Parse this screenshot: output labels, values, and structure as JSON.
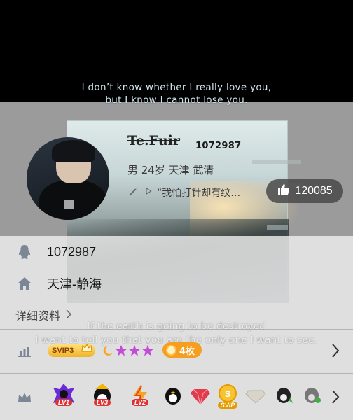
{
  "background": {
    "quote_top": [
      "I don’t know whether I really love you,",
      "but I know I cannot lose you."
    ],
    "quote_bottom": [
      "If the earth is going to be destroyed",
      "I want to tell you that you are the only one I want to see."
    ]
  },
  "profile": {
    "nickname": "Te.Fuir",
    "qq_number": "1072987",
    "info": "男 24岁 天津 武清",
    "signature": "“我怕打针却有纹…",
    "likes": "120085"
  },
  "details": {
    "qq_number": "1072987",
    "location": "天津-静海",
    "more_link": "详细资料"
  },
  "vip": {
    "svip_label": "SVIP3",
    "coin_label": "4枚"
  },
  "badges": [
    "LV1",
    "LV3",
    "LV2",
    "SVIP"
  ],
  "colors": {
    "like_pill": "#464646",
    "svip_gold": "#f0b428",
    "coin_orange": "#f59e20"
  },
  "icons": [
    "qq-penguin-icon",
    "home-icon",
    "chart-icon",
    "crown-icon",
    "thumbs-up-icon",
    "edit-pencil-icon",
    "play-icon",
    "chevron-right-icon"
  ]
}
